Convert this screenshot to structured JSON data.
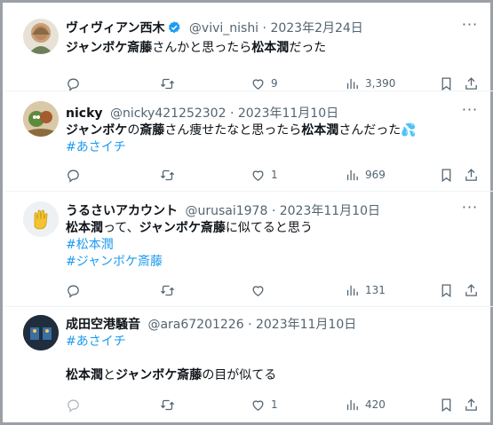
{
  "tweets": [
    {
      "name": "ヴィヴィアン西木",
      "handle": "@vivi_nishi",
      "date": "2023年2月24日",
      "verified": true,
      "lines": [
        [
          {
            "t": "ジャンボケ斎藤",
            "b": true
          },
          {
            "t": "さんかと思ったら"
          },
          {
            "t": "松本潤",
            "b": true
          },
          {
            "t": "だった"
          }
        ]
      ],
      "replies": "",
      "retweets": "",
      "likes": "9",
      "views": "3,390"
    },
    {
      "name": "nicky",
      "handle": "@nicky421252302",
      "date": "2023年11月10日",
      "verified": false,
      "lines": [
        [
          {
            "t": "ジャンボケ",
            "b": true
          },
          {
            "t": "の"
          },
          {
            "t": "斎藤",
            "b": true
          },
          {
            "t": "さん痩せたなと思ったら"
          },
          {
            "t": "松本潤",
            "b": true
          },
          {
            "t": "さんだった💦"
          }
        ],
        [
          {
            "t": "#あさイチ",
            "h": true
          }
        ]
      ],
      "replies": "",
      "retweets": "",
      "likes": "1",
      "views": "969"
    },
    {
      "name": "うるさいアカウント",
      "handle": "@urusai1978",
      "date": "2023年11月10日",
      "verified": false,
      "lines": [
        [
          {
            "t": "松本潤",
            "b": true
          },
          {
            "t": "って、"
          },
          {
            "t": "ジャンボケ斎藤",
            "b": true
          },
          {
            "t": "に似てると思う"
          }
        ],
        [
          {
            "t": "#松本潤",
            "h": true
          }
        ],
        [
          {
            "t": "#ジャンボケ斎藤",
            "h": true
          }
        ]
      ],
      "replies": "",
      "retweets": "",
      "likes": "",
      "views": "131"
    },
    {
      "name": "成田空港騒音",
      "handle": "@ara67201226",
      "date": "2023年11月10日",
      "verified": false,
      "lines": [
        [
          {
            "t": "#あさイチ",
            "h": true
          }
        ],
        [
          {
            "t": ""
          }
        ],
        [
          {
            "t": "松本潤",
            "b": true
          },
          {
            "t": "と"
          },
          {
            "t": "ジャンボケ斎藤",
            "b": true
          },
          {
            "t": "の目が似てる"
          }
        ]
      ],
      "replies": "",
      "retweets": "",
      "likes": "1",
      "views": "420"
    }
  ],
  "separator": "·",
  "more_label": "···",
  "colors": {
    "text": "#0f1419",
    "secondary": "#536471",
    "link": "#1d9bf0",
    "verified": "#1d9bf0",
    "border": "#eff3f4"
  },
  "icons": [
    "reply-icon",
    "retweet-icon",
    "like-icon",
    "views-icon",
    "bookmark-icon",
    "share-icon",
    "verified-badge-icon",
    "more-icon"
  ]
}
